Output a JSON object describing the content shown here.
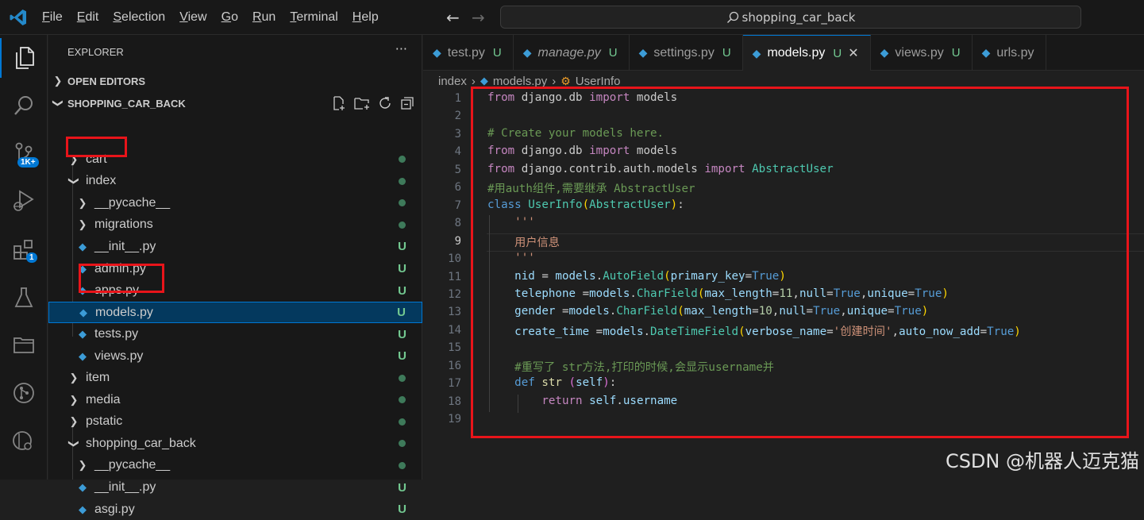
{
  "menu": [
    "File",
    "Edit",
    "Selection",
    "View",
    "Go",
    "Run",
    "Terminal",
    "Help"
  ],
  "search_text": "shopping_car_back",
  "activity_badges": {
    "source_control": "1K+",
    "extensions": "1"
  },
  "explorer": {
    "title": "EXPLORER",
    "open_editors": "OPEN EDITORS",
    "project": "SHOPPING_CAR_BACK",
    "tree": [
      {
        "label": "cart",
        "kind": "folder",
        "expanded": false,
        "indent": 1,
        "status": "dot"
      },
      {
        "label": "index",
        "kind": "folder",
        "expanded": true,
        "indent": 1,
        "status": "dot"
      },
      {
        "label": "__pycache__",
        "kind": "folder",
        "expanded": false,
        "indent": 2,
        "status": "dot"
      },
      {
        "label": "migrations",
        "kind": "folder",
        "expanded": false,
        "indent": 2,
        "status": "dot"
      },
      {
        "label": "__init__.py",
        "kind": "py",
        "indent": 2,
        "status": "U"
      },
      {
        "label": "admin.py",
        "kind": "py",
        "indent": 2,
        "status": "U"
      },
      {
        "label": "apps.py",
        "kind": "py",
        "indent": 2,
        "status": "U"
      },
      {
        "label": "models.py",
        "kind": "py",
        "indent": 2,
        "status": "U",
        "selected": true
      },
      {
        "label": "tests.py",
        "kind": "py",
        "indent": 2,
        "status": "U"
      },
      {
        "label": "views.py",
        "kind": "py",
        "indent": 2,
        "status": "U"
      },
      {
        "label": "item",
        "kind": "folder",
        "expanded": false,
        "indent": 1,
        "status": "dot"
      },
      {
        "label": "media",
        "kind": "folder",
        "expanded": false,
        "indent": 1,
        "status": "dot"
      },
      {
        "label": "pstatic",
        "kind": "folder",
        "expanded": false,
        "indent": 1,
        "status": "dot"
      },
      {
        "label": "shopping_car_back",
        "kind": "folder",
        "expanded": true,
        "indent": 1,
        "status": "dot"
      },
      {
        "label": "__pycache__",
        "kind": "folder",
        "expanded": false,
        "indent": 2,
        "status": "dot"
      },
      {
        "label": "__init__.py",
        "kind": "py",
        "indent": 2,
        "status": "U"
      },
      {
        "label": "asgi.py",
        "kind": "py",
        "indent": 2,
        "status": "U"
      }
    ]
  },
  "tabs": [
    {
      "label": "test.py",
      "status": "U",
      "italic": false,
      "active": false
    },
    {
      "label": "manage.py",
      "status": "U",
      "italic": true,
      "active": false
    },
    {
      "label": "settings.py",
      "status": "U",
      "italic": false,
      "active": false
    },
    {
      "label": "models.py",
      "status": "U",
      "italic": false,
      "active": true
    },
    {
      "label": "views.py",
      "status": "U",
      "italic": false,
      "active": false
    },
    {
      "label": "urls.py",
      "status": "",
      "italic": false,
      "active": false
    }
  ],
  "breadcrumb": [
    "index",
    "models.py",
    "UserInfo"
  ],
  "code_lines": [
    [
      [
        "kw",
        "from"
      ],
      [
        "pl",
        " django.db "
      ],
      [
        "kw",
        "import"
      ],
      [
        "pl",
        " models"
      ]
    ],
    [],
    [
      [
        "cm",
        "# Create your models here."
      ]
    ],
    [
      [
        "kw",
        "from"
      ],
      [
        "pl",
        " django.db "
      ],
      [
        "kw",
        "import"
      ],
      [
        "pl",
        " models"
      ]
    ],
    [
      [
        "kw",
        "from"
      ],
      [
        "pl",
        " django.contrib.auth.models "
      ],
      [
        "kw",
        "import"
      ],
      [
        "pl",
        " "
      ],
      [
        "cl",
        "AbstractUser"
      ]
    ],
    [
      [
        "cm",
        "#用auth组件,需要继承 AbstractUser"
      ]
    ],
    [
      [
        "bl",
        "class"
      ],
      [
        "pl",
        " "
      ],
      [
        "cl",
        "UserInfo"
      ],
      [
        "br",
        "("
      ],
      [
        "cl",
        "AbstractUser"
      ],
      [
        "br",
        ")"
      ],
      [
        "pl",
        ":"
      ]
    ],
    [
      [
        "pl",
        "    "
      ],
      [
        "st",
        "'''"
      ]
    ],
    [
      [
        "pl",
        "    "
      ],
      [
        "st",
        "用户信息"
      ]
    ],
    [
      [
        "pl",
        "    "
      ],
      [
        "st",
        "'''"
      ]
    ],
    [
      [
        "pl",
        "    "
      ],
      [
        "vr",
        "nid"
      ],
      [
        "pl",
        " = "
      ],
      [
        "vr",
        "models"
      ],
      [
        "pl",
        "."
      ],
      [
        "cl",
        "AutoField"
      ],
      [
        "br",
        "("
      ],
      [
        "vr",
        "primary_key"
      ],
      [
        "pl",
        "="
      ],
      [
        "bl",
        "True"
      ],
      [
        "br",
        ")"
      ]
    ],
    [
      [
        "pl",
        "    "
      ],
      [
        "vr",
        "telephone"
      ],
      [
        "pl",
        " ="
      ],
      [
        "vr",
        "models"
      ],
      [
        "pl",
        "."
      ],
      [
        "cl",
        "CharField"
      ],
      [
        "br",
        "("
      ],
      [
        "vr",
        "max_length"
      ],
      [
        "pl",
        "="
      ],
      [
        "nm",
        "11"
      ],
      [
        "pl",
        ","
      ],
      [
        "vr",
        "null"
      ],
      [
        "pl",
        "="
      ],
      [
        "bl",
        "True"
      ],
      [
        "pl",
        ","
      ],
      [
        "vr",
        "unique"
      ],
      [
        "pl",
        "="
      ],
      [
        "bl",
        "True"
      ],
      [
        "br",
        ")"
      ]
    ],
    [
      [
        "pl",
        "    "
      ],
      [
        "vr",
        "gender"
      ],
      [
        "pl",
        " ="
      ],
      [
        "vr",
        "models"
      ],
      [
        "pl",
        "."
      ],
      [
        "cl",
        "CharField"
      ],
      [
        "br",
        "("
      ],
      [
        "vr",
        "max_length"
      ],
      [
        "pl",
        "="
      ],
      [
        "nm",
        "10"
      ],
      [
        "pl",
        ","
      ],
      [
        "vr",
        "null"
      ],
      [
        "pl",
        "="
      ],
      [
        "bl",
        "True"
      ],
      [
        "pl",
        ","
      ],
      [
        "vr",
        "unique"
      ],
      [
        "pl",
        "="
      ],
      [
        "bl",
        "True"
      ],
      [
        "br",
        ")"
      ]
    ],
    [
      [
        "pl",
        "    "
      ],
      [
        "vr",
        "create_time"
      ],
      [
        "pl",
        " ="
      ],
      [
        "vr",
        "models"
      ],
      [
        "pl",
        "."
      ],
      [
        "cl",
        "DateTimeField"
      ],
      [
        "br",
        "("
      ],
      [
        "vr",
        "verbose_name"
      ],
      [
        "pl",
        "="
      ],
      [
        "st",
        "'创建时间'"
      ],
      [
        "pl",
        ","
      ],
      [
        "vr",
        "auto_now_add"
      ],
      [
        "pl",
        "="
      ],
      [
        "bl",
        "True"
      ],
      [
        "br",
        ")"
      ]
    ],
    [],
    [
      [
        "pl",
        "    "
      ],
      [
        "cm",
        "#重写了 str方法,打印的时候,会显示username并"
      ]
    ],
    [
      [
        "pl",
        "    "
      ],
      [
        "bl",
        "def"
      ],
      [
        "pl",
        " "
      ],
      [
        "fn",
        "str"
      ],
      [
        "pl",
        " "
      ],
      [
        "br2",
        "("
      ],
      [
        "vr",
        "self"
      ],
      [
        "br2",
        ")"
      ],
      [
        "pl",
        ":"
      ]
    ],
    [
      [
        "pl",
        "        "
      ],
      [
        "kw",
        "return"
      ],
      [
        "pl",
        " "
      ],
      [
        "vr",
        "self"
      ],
      [
        "pl",
        "."
      ],
      [
        "vr",
        "username"
      ]
    ],
    []
  ],
  "current_line": 9,
  "watermark": "CSDN @机器人迈克猫"
}
